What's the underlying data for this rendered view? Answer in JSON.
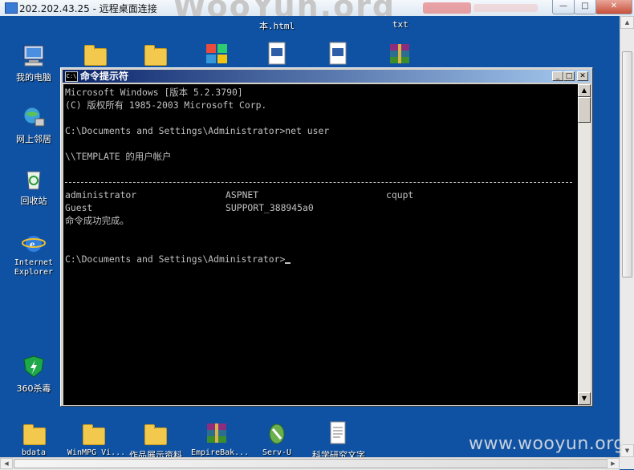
{
  "rdp": {
    "title": "202.202.43.25 - 远程桌面连接",
    "watermark": "WooYun.org",
    "controls": [
      "—",
      "□",
      "✕"
    ]
  },
  "desktop": {
    "top_files": [
      "本.html",
      "txt"
    ],
    "left_icons": [
      "我的电脑",
      "网上邻居",
      "回收站",
      "Internet\nExplorer",
      "360杀毒"
    ],
    "bottom_icons": [
      "bdata",
      "WinMPG Vi...",
      "作品展示资料",
      "EmpireBak...",
      "Serv-U",
      "科学研究文字"
    ]
  },
  "cmd": {
    "title": "命令提示符",
    "icon_text": "C:\\",
    "lines": [
      "Microsoft Windows [版本 5.2.3790]",
      "(C) 版权所有 1985-2003 Microsoft Corp.",
      "C:\\Documents and Settings\\Administrator>net user",
      "\\\\TEMPLATE 的用户帐户",
      "命令成功完成。",
      "C:\\Documents and Settings\\Administrator>"
    ],
    "users_col1": [
      "administrator",
      "Guest"
    ],
    "users_col2": [
      "ASPNET",
      "SUPPORT_388945a0"
    ],
    "users_col3": [
      "cqupt"
    ]
  },
  "watermark_bottom": "www.wooyun.org"
}
